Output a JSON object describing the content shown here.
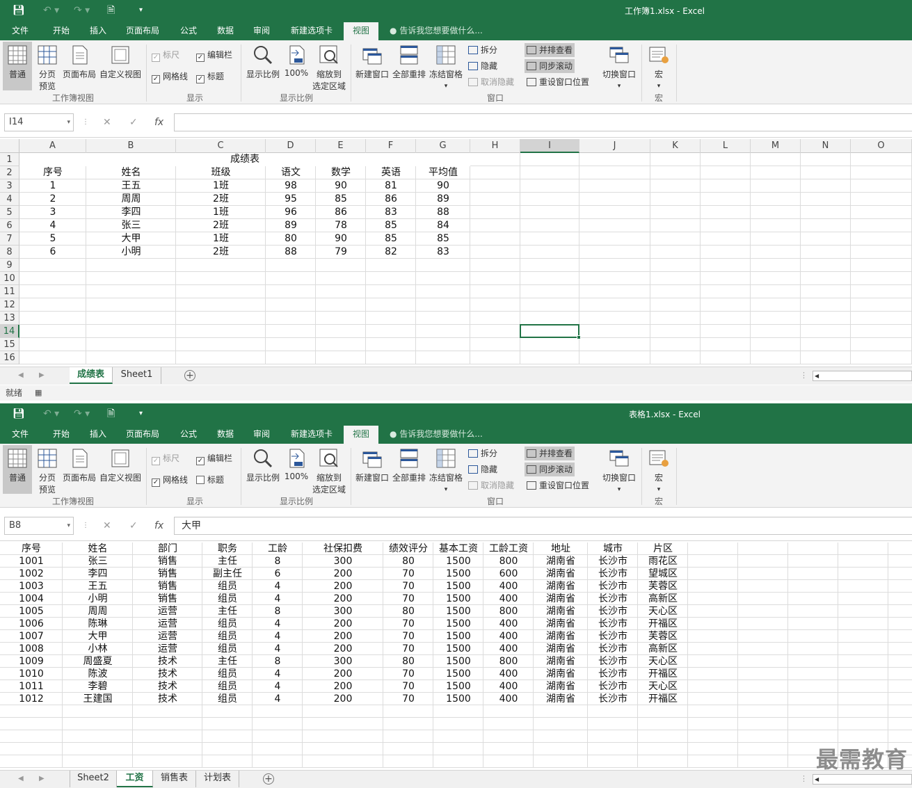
{
  "ribbon_tabs": [
    "文件",
    "开始",
    "插入",
    "页面布局",
    "公式",
    "数据",
    "审阅",
    "新建选项卡",
    "视图"
  ],
  "tell_me": "告诉我您想要做什么...",
  "groups": {
    "workbook_views": {
      "label": "工作簿视图",
      "normal": "普通",
      "page_break_1": "分页",
      "page_break_2": "预览",
      "page_layout": "页面布局",
      "custom_view": "自定义视图"
    },
    "show": {
      "label": "显示",
      "ruler": "标尺",
      "formula_bar": "编辑栏",
      "gridlines": "网格线",
      "headings": "标题"
    },
    "zoom": {
      "label": "显示比例",
      "zoom": "显示比例",
      "zoom100": "100%",
      "zoom_sel_1": "缩放到",
      "zoom_sel_2": "选定区域"
    },
    "window": {
      "label": "窗口",
      "new_window": "新建窗口",
      "arrange_all": "全部重排",
      "freeze": "冻结窗格",
      "split": "拆分",
      "hide": "隐藏",
      "unhide": "取消隐藏",
      "side_by_side": "并排查看",
      "sync_scroll": "同步滚动",
      "reset_pos": "重设窗口位置",
      "switch": "切换窗口"
    },
    "macros": {
      "label": "宏",
      "macros": "宏"
    }
  },
  "window1": {
    "title": "工作簿1.xlsx - Excel",
    "name_box": "I14",
    "formula": "",
    "columns": [
      "A",
      "B",
      "C",
      "D",
      "E",
      "F",
      "G",
      "H",
      "I",
      "J",
      "K",
      "L",
      "M",
      "N",
      "O"
    ],
    "rows": [
      "1",
      "2",
      "3",
      "4",
      "5",
      "6",
      "7",
      "8",
      "9",
      "10",
      "11",
      "12",
      "13",
      "14",
      "15",
      "16"
    ],
    "sheet_title": "成绩表",
    "headers": [
      "序号",
      "姓名",
      "班级",
      "语文",
      "数学",
      "英语",
      "平均值"
    ],
    "data": [
      [
        "1",
        "王五",
        "1班",
        "98",
        "90",
        "81",
        "90"
      ],
      [
        "2",
        "周周",
        "2班",
        "95",
        "85",
        "86",
        "89"
      ],
      [
        "3",
        "李四",
        "1班",
        "96",
        "86",
        "83",
        "88"
      ],
      [
        "4",
        "张三",
        "2班",
        "89",
        "78",
        "85",
        "84"
      ],
      [
        "5",
        "大甲",
        "1班",
        "80",
        "90",
        "85",
        "85"
      ],
      [
        "6",
        "小明",
        "2班",
        "88",
        "79",
        "82",
        "83"
      ]
    ],
    "sheets": [
      "成绩表",
      "Sheet1"
    ],
    "status": "就绪",
    "show": {
      "ruler": false,
      "formula_bar": true,
      "gridlines": true,
      "headings": true
    }
  },
  "window2": {
    "title": "表格1.xlsx - Excel",
    "name_box": "B8",
    "formula": "大甲",
    "headers": [
      "序号",
      "姓名",
      "部门",
      "职务",
      "工龄",
      "社保扣费",
      "绩效评分",
      "基本工资",
      "工龄工资",
      "地址",
      "城市",
      "片区"
    ],
    "data": [
      [
        "1001",
        "张三",
        "销售",
        "主任",
        "8",
        "300",
        "80",
        "1500",
        "800",
        "湖南省",
        "长沙市",
        "雨花区"
      ],
      [
        "1002",
        "李四",
        "销售",
        "副主任",
        "6",
        "200",
        "70",
        "1500",
        "600",
        "湖南省",
        "长沙市",
        "望城区"
      ],
      [
        "1003",
        "王五",
        "销售",
        "组员",
        "4",
        "200",
        "70",
        "1500",
        "400",
        "湖南省",
        "长沙市",
        "芙蓉区"
      ],
      [
        "1004",
        "小明",
        "销售",
        "组员",
        "4",
        "200",
        "70",
        "1500",
        "400",
        "湖南省",
        "长沙市",
        "高新区"
      ],
      [
        "1005",
        "周周",
        "运营",
        "主任",
        "8",
        "300",
        "80",
        "1500",
        "800",
        "湖南省",
        "长沙市",
        "天心区"
      ],
      [
        "1006",
        "陈琳",
        "运营",
        "组员",
        "4",
        "200",
        "70",
        "1500",
        "400",
        "湖南省",
        "长沙市",
        "开福区"
      ],
      [
        "1007",
        "大甲",
        "运营",
        "组员",
        "4",
        "200",
        "70",
        "1500",
        "400",
        "湖南省",
        "长沙市",
        "芙蓉区"
      ],
      [
        "1008",
        "小林",
        "运营",
        "组员",
        "4",
        "200",
        "70",
        "1500",
        "400",
        "湖南省",
        "长沙市",
        "高新区"
      ],
      [
        "1009",
        "周盛夏",
        "技术",
        "主任",
        "8",
        "300",
        "80",
        "1500",
        "800",
        "湖南省",
        "长沙市",
        "天心区"
      ],
      [
        "1010",
        "陈波",
        "技术",
        "组员",
        "4",
        "200",
        "70",
        "1500",
        "400",
        "湖南省",
        "长沙市",
        "开福区"
      ],
      [
        "1011",
        "李碧",
        "技术",
        "组员",
        "4",
        "200",
        "70",
        "1500",
        "400",
        "湖南省",
        "长沙市",
        "天心区"
      ],
      [
        "1012",
        "王建国",
        "技术",
        "组员",
        "4",
        "200",
        "70",
        "1500",
        "400",
        "湖南省",
        "长沙市",
        "开福区"
      ]
    ],
    "sheets": [
      "Sheet2",
      "工资",
      "销售表",
      "计划表"
    ],
    "show": {
      "ruler": false,
      "formula_bar": true,
      "gridlines": true,
      "headings": false
    }
  },
  "watermark": "最需教育",
  "colors": {
    "excel_green": "#217346",
    "ribbon_bg": "#f3f3f3"
  }
}
